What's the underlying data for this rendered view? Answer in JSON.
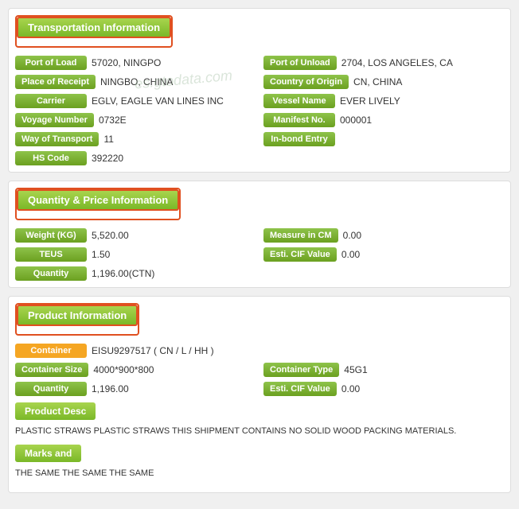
{
  "transportation": {
    "header": "Transportation Information",
    "fields": {
      "port_of_load_label": "Port of Load",
      "port_of_load_value": "57020, NINGPO",
      "port_of_unload_label": "Port of Unload",
      "port_of_unload_value": "2704, LOS ANGELES, CA",
      "place_of_receipt_label": "Place of Receipt",
      "place_of_receipt_value": "NINGBO, CHINA",
      "country_of_origin_label": "Country of Origin",
      "country_of_origin_value": "CN, CHINA",
      "carrier_label": "Carrier",
      "carrier_value": "EGLV, EAGLE VAN LINES INC",
      "vessel_name_label": "Vessel Name",
      "vessel_name_value": "EVER LIVELY",
      "voyage_number_label": "Voyage Number",
      "voyage_number_value": "0732E",
      "manifest_no_label": "Manifest No.",
      "manifest_no_value": "000001",
      "way_of_transport_label": "Way of Transport",
      "way_of_transport_value": "11",
      "in_bond_entry_label": "In-bond Entry",
      "in_bond_entry_value": "",
      "hs_code_label": "HS Code",
      "hs_code_value": "392220"
    }
  },
  "quantity": {
    "header": "Quantity & Price Information",
    "fields": {
      "weight_label": "Weight (KG)",
      "weight_value": "5,520.00",
      "measure_label": "Measure in CM",
      "measure_value": "0.00",
      "teus_label": "TEUS",
      "teus_value": "1.50",
      "esti_cif_label": "Esti. CIF Value",
      "esti_cif_value": "0.00",
      "quantity_label": "Quantity",
      "quantity_value": "1,196.00(CTN)"
    }
  },
  "product": {
    "header": "Product Information",
    "container_label": "Container",
    "container_value": "EISU9297517 ( CN / L / HH )",
    "container_size_label": "Container Size",
    "container_size_value": "4000*900*800",
    "container_type_label": "Container Type",
    "container_type_value": "45G1",
    "quantity_label": "Quantity",
    "quantity_value": "1,196.00",
    "esti_cif_label": "Esti. CIF Value",
    "esti_cif_value": "0.00",
    "product_desc_label": "Product Desc",
    "product_desc_text": "PLASTIC STRAWS PLASTIC STRAWS THIS SHIPMENT CONTAINS NO SOLID WOOD PACKING MATERIALS.",
    "marks_label": "Marks and",
    "marks_text": "THE SAME THE SAME THE SAME"
  },
  "watermark": "es.gtodata.com"
}
